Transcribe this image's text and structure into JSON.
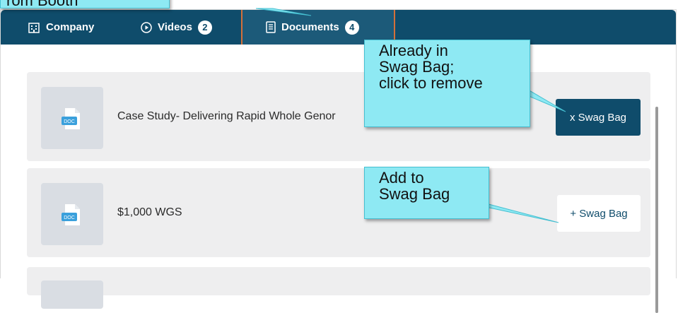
{
  "tabs": [
    {
      "label": "Company",
      "icon": "building-icon"
    },
    {
      "label": "Videos",
      "icon": "play-circle-icon",
      "count": "2"
    },
    {
      "label": "Documents",
      "icon": "document-icon",
      "count": "4",
      "active": true
    }
  ],
  "documents": [
    {
      "title": "Case Study- Delivering Rapid Whole Genor",
      "thumb_label": "DOC",
      "action": "x Swag Bag",
      "in_swag_bag": true
    },
    {
      "title": "$1,000 WGS",
      "thumb_label": "DOC",
      "action": "+ Swag Bag",
      "in_swag_bag": false
    }
  ],
  "callouts": {
    "top": "rom Booth",
    "remove": "Already in\nSwag Bag;\nclick to remove",
    "add": "Add to\nSwag Bag"
  },
  "colors": {
    "tabbar": "#0f4c6b",
    "active_tab": "#1c5a79",
    "tab_border": "#d4703a",
    "callout": "#8ee9f3"
  }
}
